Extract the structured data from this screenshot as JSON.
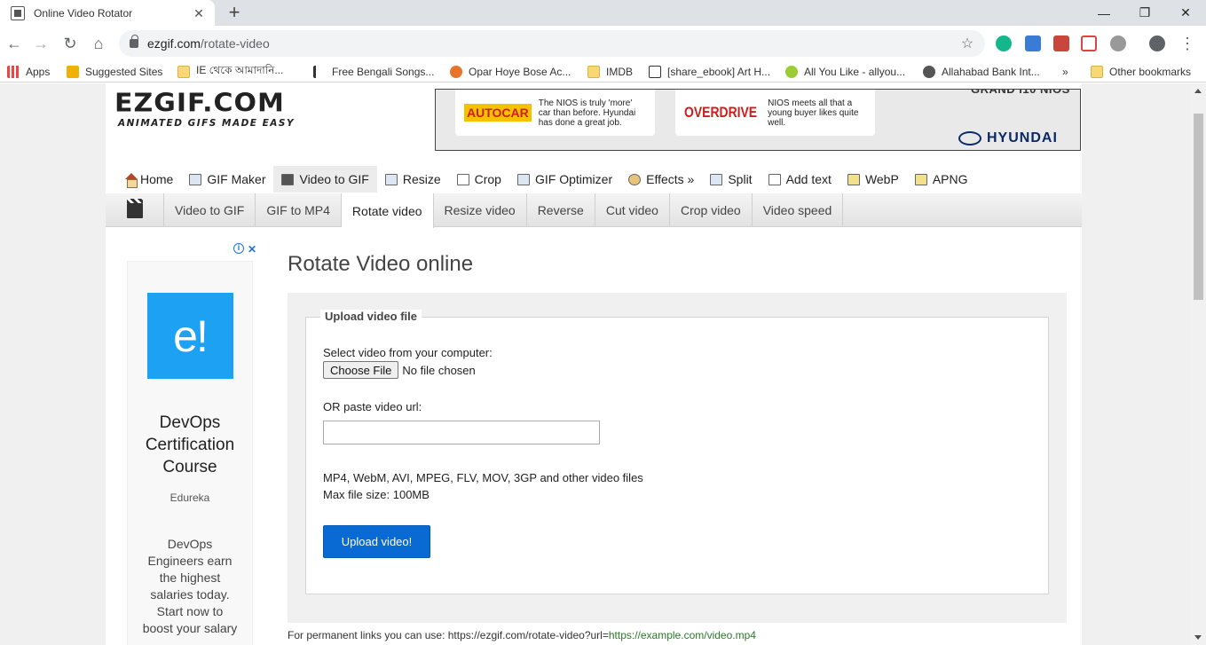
{
  "browser": {
    "tab_title": "Online Video Rotator",
    "tab_close": "✕",
    "new_tab": "+",
    "window_controls": {
      "minimize": "—",
      "maximize": "❐",
      "close": "✕"
    },
    "url_domain": "ezgif.com",
    "url_path": "/rotate-video",
    "bookmarks": [
      "Apps",
      "Suggested Sites",
      "IE থেকে আমাদানি...",
      "Free Bengali Songs...",
      "Opar Hoye Bose Ac...",
      "IMDB",
      "[share_ebook] Art H...",
      "All You Like - allyou...",
      "Allahabad Bank  Int..."
    ],
    "bookmarks_overflow": "»",
    "other_bookmarks": "Other bookmarks"
  },
  "site": {
    "logo_main": "EZGIF.COM",
    "logo_sub": "ANIMATED GIFS MADE EASY"
  },
  "banner": {
    "autocar_brand": "AUTOCAR",
    "autocar_text": "The NIOS is truly 'more' car than before. Hyundai has done a great job.",
    "overdrive_brand": "OVERDRIVE",
    "overdrive_text": "NIOS meets all that a young buyer likes quite well.",
    "top_right": "GRAND i10 NIOS",
    "logo": "HYUNDAI"
  },
  "nav": {
    "items": [
      "Home",
      "GIF Maker",
      "Video to GIF",
      "Resize",
      "Crop",
      "GIF Optimizer",
      "Effects »",
      "Split",
      "Add text",
      "WebP",
      "APNG"
    ],
    "active": "Video to GIF"
  },
  "subnav": {
    "items": [
      "Video to GIF",
      "GIF to MP4",
      "Rotate video",
      "Resize video",
      "Reverse",
      "Cut video",
      "Crop video",
      "Video speed"
    ],
    "active": "Rotate video"
  },
  "ad": {
    "choice_info": "i",
    "choice_close": "✕",
    "logo_text": "e!",
    "title": "DevOps Certification Course",
    "brand": "Edureka",
    "description": "DevOps Engineers earn the highest salaries today. Start now to boost your salary"
  },
  "main": {
    "title": "Rotate Video online",
    "legend": "Upload video file",
    "select_label": "Select video from your computer:",
    "choose_file": "Choose File",
    "file_status": "No file chosen",
    "url_label": "OR paste video url:",
    "url_value": "",
    "formats": "MP4, WebM, AVI, MPEG, FLV, MOV, 3GP and other video files",
    "max_size": "Max file size: 100MB",
    "upload_button": "Upload video!",
    "permalink_prefix": "For permanent links you can use: https://ezgif.com/rotate-video?url=",
    "permalink_example": "https://example.com/video.mp4"
  }
}
